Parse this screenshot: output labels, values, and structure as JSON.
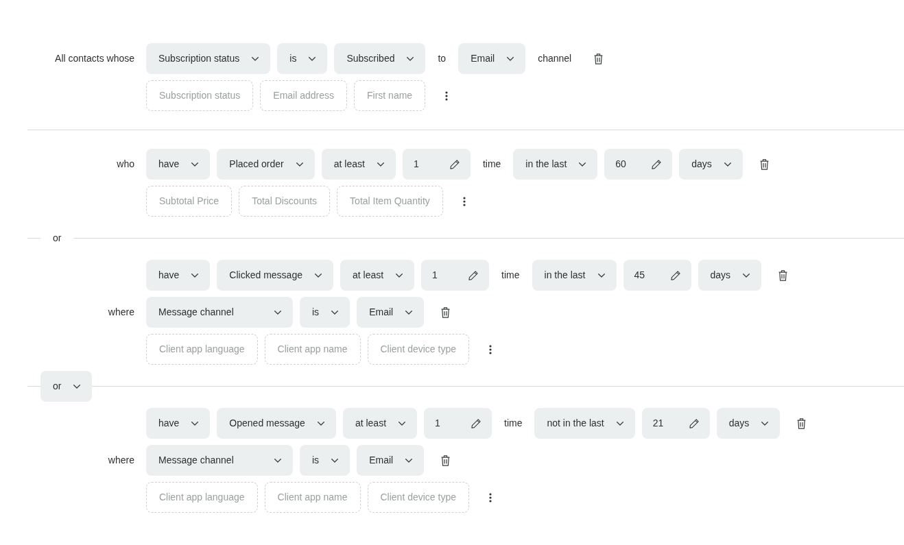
{
  "blocks": [
    {
      "kind": "condition",
      "rows": [
        {
          "label": "All contacts whose",
          "parts": [
            {
              "kind": "select",
              "text": "Subscription status"
            },
            {
              "kind": "select",
              "text": "is"
            },
            {
              "kind": "select",
              "text": "Subscribed"
            },
            {
              "kind": "text",
              "text": "to"
            },
            {
              "kind": "select",
              "text": "Email"
            },
            {
              "kind": "text",
              "text": "channel"
            },
            {
              "kind": "delete"
            }
          ]
        }
      ],
      "suggestions": [
        "Subscription status",
        "Email address",
        "First name"
      ]
    },
    {
      "kind": "rule"
    },
    {
      "kind": "condition",
      "rows": [
        {
          "label": "who",
          "parts": [
            {
              "kind": "select",
              "text": "have"
            },
            {
              "kind": "select",
              "text": "Placed order"
            },
            {
              "kind": "select",
              "text": "at least"
            },
            {
              "kind": "number",
              "value": "1"
            },
            {
              "kind": "text",
              "text": "time"
            },
            {
              "kind": "select",
              "text": "in the last"
            },
            {
              "kind": "number",
              "value": "60"
            },
            {
              "kind": "select",
              "text": "days"
            },
            {
              "kind": "delete"
            }
          ]
        }
      ],
      "suggestions": [
        "Subtotal Price",
        "Total Discounts",
        "Total Item Quantity"
      ]
    },
    {
      "kind": "joiner",
      "text": "or"
    },
    {
      "kind": "condition",
      "rows": [
        {
          "parts": [
            {
              "kind": "select",
              "text": "have"
            },
            {
              "kind": "select",
              "text": "Clicked message"
            },
            {
              "kind": "select",
              "text": "at least"
            },
            {
              "kind": "number",
              "value": "1"
            },
            {
              "kind": "text",
              "text": "time"
            },
            {
              "kind": "select",
              "text": "in the last"
            },
            {
              "kind": "number",
              "value": "45"
            },
            {
              "kind": "select",
              "text": "days"
            },
            {
              "kind": "delete"
            }
          ]
        },
        {
          "label": "where",
          "parts": [
            {
              "kind": "select",
              "text": "Message channel"
            },
            {
              "kind": "select",
              "text": "is"
            },
            {
              "kind": "select",
              "text": "Email"
            },
            {
              "kind": "delete"
            }
          ]
        }
      ],
      "suggestions": [
        "Client app language",
        "Client app name",
        "Client device type"
      ]
    },
    {
      "kind": "switch",
      "text": "or"
    },
    {
      "kind": "condition",
      "rows": [
        {
          "parts": [
            {
              "kind": "select",
              "text": "have"
            },
            {
              "kind": "select",
              "text": "Opened message"
            },
            {
              "kind": "select",
              "text": "at least"
            },
            {
              "kind": "number",
              "value": "1"
            },
            {
              "kind": "text",
              "text": "time"
            },
            {
              "kind": "select",
              "text": "not in the last"
            },
            {
              "kind": "number",
              "value": "21"
            },
            {
              "kind": "select",
              "text": "days"
            },
            {
              "kind": "delete"
            }
          ]
        },
        {
          "label": "where",
          "parts": [
            {
              "kind": "select",
              "text": "Message channel"
            },
            {
              "kind": "select",
              "text": "is"
            },
            {
              "kind": "select",
              "text": "Email"
            },
            {
              "kind": "delete"
            }
          ]
        }
      ],
      "suggestions": [
        "Client app language",
        "Client app name",
        "Client device type"
      ]
    }
  ]
}
